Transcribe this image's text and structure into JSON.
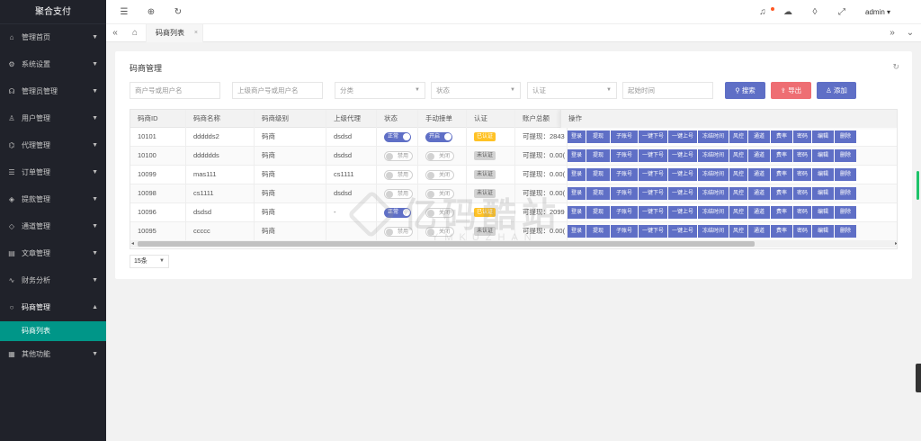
{
  "app": {
    "title": "聚合支付"
  },
  "sidebar": {
    "items": [
      {
        "icon": "home-icon",
        "glyph": "⌂",
        "label": "管理首页"
      },
      {
        "icon": "gear-icon",
        "glyph": "⚙",
        "label": "系统设置"
      },
      {
        "icon": "headset-icon",
        "glyph": "☊",
        "label": "管理员管理"
      },
      {
        "icon": "user-icon",
        "glyph": "♙",
        "label": "用户管理"
      },
      {
        "icon": "agent-icon",
        "glyph": "⌬",
        "label": "代理管理"
      },
      {
        "icon": "order-icon",
        "glyph": "☰",
        "label": "订单管理"
      },
      {
        "icon": "withdraw-icon",
        "glyph": "◈",
        "label": "提款管理"
      },
      {
        "icon": "diamond-icon",
        "glyph": "◇",
        "label": "通道管理"
      },
      {
        "icon": "article-icon",
        "glyph": "▤",
        "label": "文章管理"
      },
      {
        "icon": "chart-icon",
        "glyph": "∿",
        "label": "财务分析"
      },
      {
        "icon": "circle-icon",
        "glyph": "○",
        "label": "码商管理"
      }
    ],
    "submenu": [
      {
        "label": "码商列表"
      }
    ],
    "last_item": {
      "icon": "apps-icon",
      "glyph": "▦",
      "label": "其他功能"
    }
  },
  "topbar": {
    "user": "admin ▾"
  },
  "tabs": {
    "active": "码商列表",
    "close": "×"
  },
  "card": {
    "title": "码商管理"
  },
  "filters": {
    "merchant_placeholder": "商户号或用户名",
    "parent_placeholder": "上级商户号或用户名",
    "category": "分类",
    "status": "状态",
    "auth": "认证",
    "start_time_placeholder": "起始时间"
  },
  "buttons": {
    "search": "搜索",
    "export": "导出",
    "add": "添加"
  },
  "table": {
    "headers": [
      "码商ID",
      "码商名称",
      "码商级别",
      "上级代理",
      "状态",
      "手动接单",
      "认证",
      "账户总额",
      "操作"
    ],
    "rows": [
      {
        "id": "10101",
        "name": "ddddds2",
        "level": "码商",
        "parent": "dsdsd",
        "status": "正常",
        "status_on": true,
        "manual": "开启",
        "manual_on": true,
        "auth": "已认证",
        "auth_ok": true,
        "balance": "可提现：2843"
      },
      {
        "id": "10100",
        "name": "dddddds",
        "level": "码商",
        "parent": "dsdsd",
        "status": "禁用",
        "status_on": false,
        "manual": "关闭",
        "manual_on": false,
        "auth": "未认证",
        "auth_ok": false,
        "balance": "可提现：0.00("
      },
      {
        "id": "10099",
        "name": "mas111",
        "level": "码商",
        "parent": "cs1111",
        "status": "禁用",
        "status_on": false,
        "manual": "关闭",
        "manual_on": false,
        "auth": "未认证",
        "auth_ok": false,
        "balance": "可提现：0.00("
      },
      {
        "id": "10098",
        "name": "cs1111",
        "level": "码商",
        "parent": "dsdsd",
        "status": "禁用",
        "status_on": false,
        "manual": "关闭",
        "manual_on": false,
        "auth": "未认证",
        "auth_ok": false,
        "balance": "可提现：0.00("
      },
      {
        "id": "10096",
        "name": "dsdsd",
        "level": "码商",
        "parent": "-",
        "status": "正常",
        "status_on": true,
        "manual": "关闭",
        "manual_on": false,
        "auth": "已认证",
        "auth_ok": true,
        "balance": "可提现：2099"
      },
      {
        "id": "10095",
        "name": "ccccc",
        "level": "码商",
        "parent": "",
        "status": "禁用",
        "status_on": false,
        "manual": "关闭",
        "manual_on": false,
        "auth": "未认证",
        "auth_ok": false,
        "balance": "可提现：0.00("
      }
    ],
    "actions": [
      "登录",
      "提现",
      "子账号",
      "一键下号",
      "一键上号",
      "冻结时间",
      "风控",
      "通道",
      "费率",
      "密码",
      "编辑",
      "删除"
    ]
  },
  "pager": {
    "size": "15条"
  },
  "watermark": {
    "text": "亿码酷站",
    "sub": "YMKUZHAN"
  }
}
